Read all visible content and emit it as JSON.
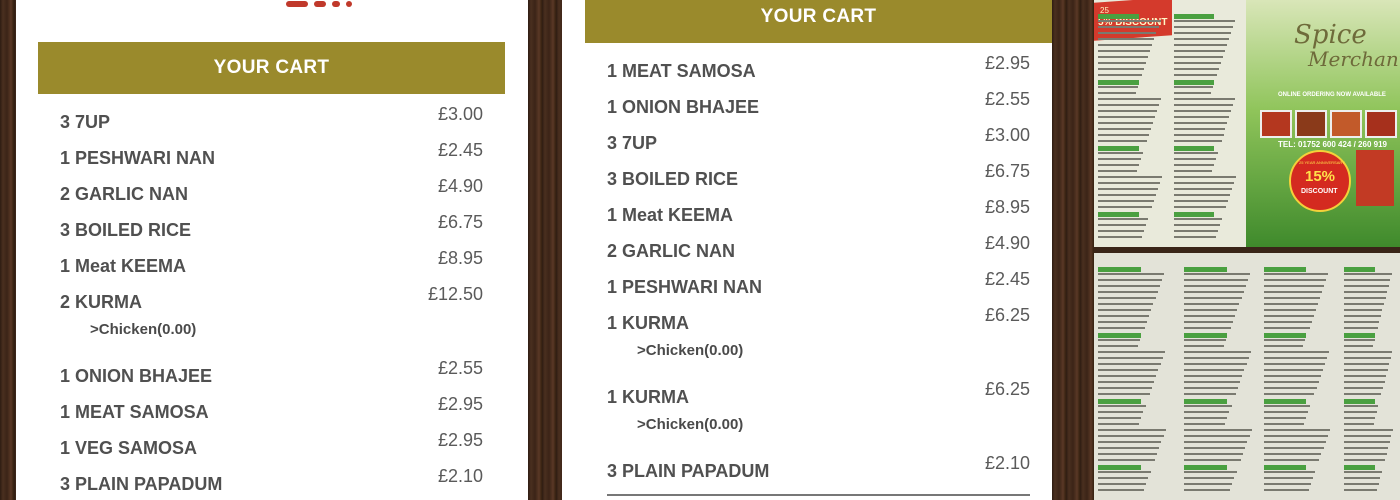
{
  "panels": [
    {
      "header": "YOUR CART",
      "items": [
        {
          "name": "3 7UP",
          "price": "£3.00"
        },
        {
          "name": "1 PESHWARI NAN",
          "price": "£2.45"
        },
        {
          "name": "2 GARLIC NAN",
          "price": "£4.90"
        },
        {
          "name": "3 BOILED RICE",
          "price": "£6.75"
        },
        {
          "name": "1 Meat KEEMA",
          "price": "£8.95"
        },
        {
          "name": "2 KURMA",
          "price": "£12.50",
          "option": ">Chicken(0.00)"
        },
        {
          "name": "1 ONION BHAJEE",
          "price": "£2.55"
        },
        {
          "name": "1 MEAT SAMOSA",
          "price": "£2.95"
        },
        {
          "name": "1 VEG SAMOSA",
          "price": "£2.95"
        },
        {
          "name": "3 PLAIN PAPADUM",
          "price": "£2.10"
        }
      ]
    },
    {
      "header": "YOUR CART",
      "items": [
        {
          "name": "1 MEAT SAMOSA",
          "price": "£2.95"
        },
        {
          "name": "1 ONION BHAJEE",
          "price": "£2.55"
        },
        {
          "name": "3 7UP",
          "price": "£3.00"
        },
        {
          "name": "3 BOILED RICE",
          "price": "£6.75"
        },
        {
          "name": "1 Meat KEEMA",
          "price": "£8.95"
        },
        {
          "name": "2 GARLIC NAN",
          "price": "£4.90"
        },
        {
          "name": "1 PESHWARI NAN",
          "price": "£2.45"
        },
        {
          "name": "1 KURMA",
          "price": "£6.25",
          "option": ">Chicken(0.00)"
        },
        {
          "name": "1 KURMA",
          "price": "£6.25",
          "option": ">Chicken(0.00)"
        },
        {
          "name": "3 PLAIN PAPADUM",
          "price": "£2.10"
        }
      ]
    }
  ],
  "menu_photo": {
    "brand_line1": "Spice",
    "brand_line2": "Merchant",
    "tagline": "ONLINE ORDERING NOW AVAILABLE",
    "telephone": "TEL: 01752 600 424 / 260 919",
    "badge_top": "25 YEAR ANNIVERSARY",
    "badge_pct": "15%",
    "badge_bottom": "DISCOUNT",
    "corner_promo_top": "25",
    "corner_promo": "5% DISCOUNT"
  },
  "colors": {
    "header_olive": "#9a8a2c",
    "wood": "#3a2518",
    "menu_green": "#4aa040",
    "badge_red": "#d42a20"
  }
}
